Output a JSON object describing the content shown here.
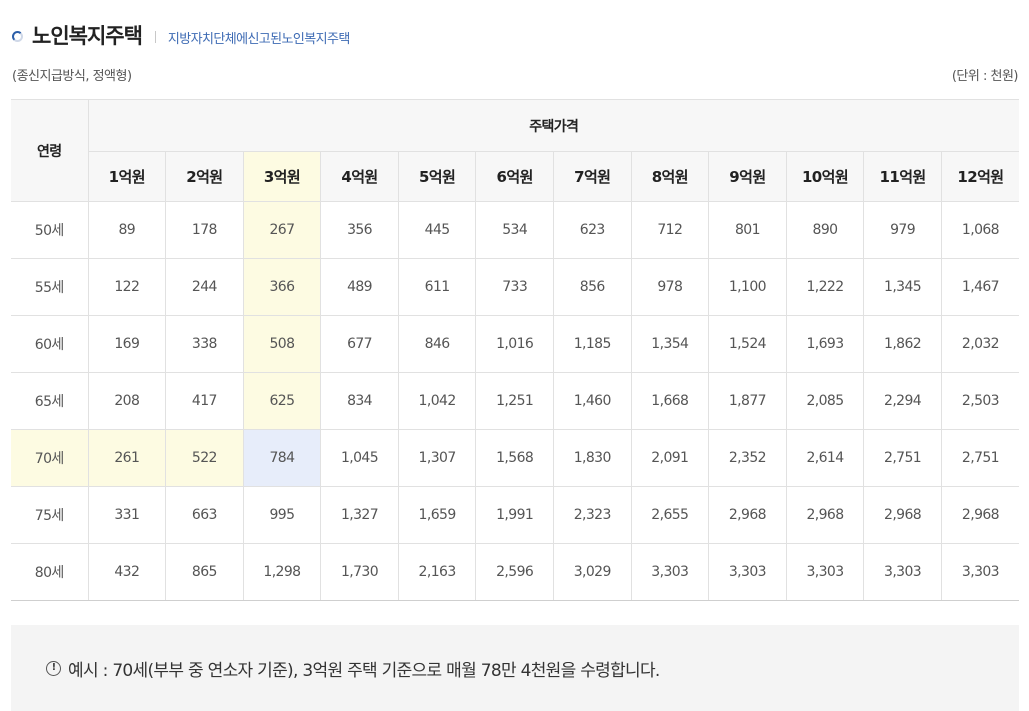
{
  "header": {
    "title": "노인복지주택",
    "subtitle": "지방자치단체에신고된노인복지주택"
  },
  "meta": {
    "left": "(종신지급방식, 정액형)",
    "right": "(단위 : 천원)"
  },
  "table": {
    "row_header": "연령",
    "group_header": "주택가격",
    "columns": [
      "1억원",
      "2억원",
      "3억원",
      "4억원",
      "5억원",
      "6억원",
      "7억원",
      "8억원",
      "9억원",
      "10억원",
      "11억원",
      "12억원"
    ],
    "rows": [
      {
        "age": "50세",
        "values": [
          "89",
          "178",
          "267",
          "356",
          "445",
          "534",
          "623",
          "712",
          "801",
          "890",
          "979",
          "1,068"
        ]
      },
      {
        "age": "55세",
        "values": [
          "122",
          "244",
          "366",
          "489",
          "611",
          "733",
          "856",
          "978",
          "1,100",
          "1,222",
          "1,345",
          "1,467"
        ]
      },
      {
        "age": "60세",
        "values": [
          "169",
          "338",
          "508",
          "677",
          "846",
          "1,016",
          "1,185",
          "1,354",
          "1,524",
          "1,693",
          "1,862",
          "2,032"
        ]
      },
      {
        "age": "65세",
        "values": [
          "208",
          "417",
          "625",
          "834",
          "1,042",
          "1,251",
          "1,460",
          "1,668",
          "1,877",
          "2,085",
          "2,294",
          "2,503"
        ]
      },
      {
        "age": "70세",
        "values": [
          "261",
          "522",
          "784",
          "1,045",
          "1,307",
          "1,568",
          "1,830",
          "2,091",
          "2,352",
          "2,614",
          "2,751",
          "2,751"
        ]
      },
      {
        "age": "75세",
        "values": [
          "331",
          "663",
          "995",
          "1,327",
          "1,659",
          "1,991",
          "2,323",
          "2,655",
          "2,968",
          "2,968",
          "2,968",
          "2,968"
        ]
      },
      {
        "age": "80세",
        "values": [
          "432",
          "865",
          "1,298",
          "1,730",
          "2,163",
          "2,596",
          "3,029",
          "3,303",
          "3,303",
          "3,303",
          "3,303",
          "3,303"
        ]
      }
    ],
    "highlight": {
      "column_index": 2,
      "row_index": 4
    },
    "colors": {
      "highlight": "#fdfbe2",
      "intersection": "#e7edfa",
      "header_bg": "#f7f7f7"
    }
  },
  "note": {
    "icon": "info-circle-icon",
    "icon_glyph": "!",
    "text": "예시 : 70세(부부 중 연소자 기준), 3억원 주택 기준으로 매월 78만 4천원을 수령합니다."
  },
  "colors": {
    "accent": "#3e6bb4",
    "note_bg": "#f4f4f4"
  }
}
